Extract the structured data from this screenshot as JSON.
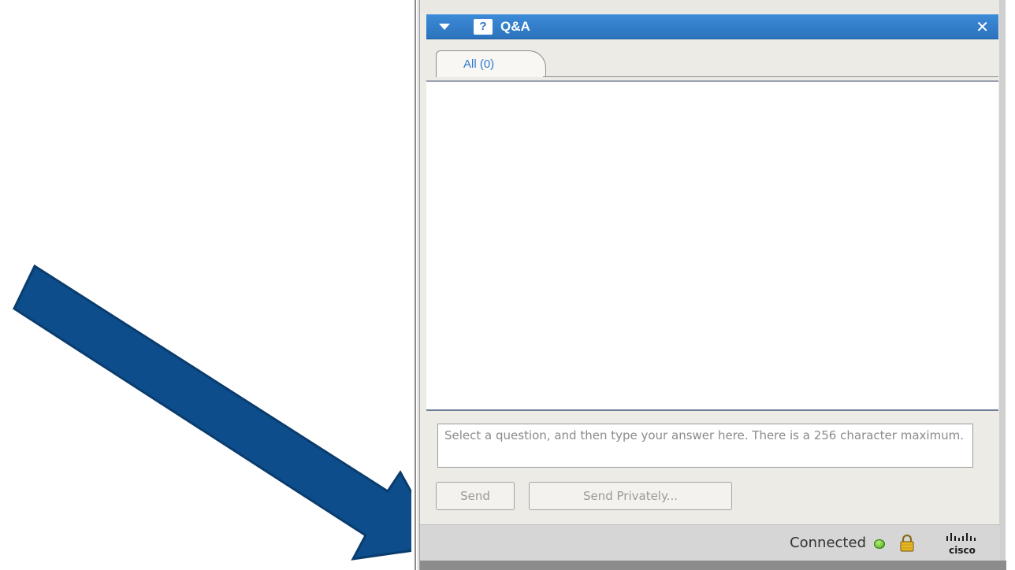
{
  "panel": {
    "title": "Q&A",
    "qa_icon_glyph": "?",
    "close_glyph": "✕"
  },
  "tabs": [
    {
      "label": "All (0)"
    }
  ],
  "answer_input": {
    "placeholder": "Select a question, and then type your answer here. There is a 256 character maximum."
  },
  "buttons": {
    "send": "Send",
    "send_privately": "Send Privately..."
  },
  "status": {
    "text": "Connected",
    "indicator_color": "#3fa214",
    "brand": "cisco"
  },
  "icons": {
    "collapse": "triangle-down-icon",
    "qa": "question-mark-icon",
    "close": "close-icon",
    "lock": "lock-icon",
    "connection": "green-dot-icon",
    "logo": "cisco-logo"
  },
  "colors": {
    "titlebar": "#2c73bd",
    "tab_text": "#2d7bd0",
    "arrow": "#0d4d8c"
  }
}
